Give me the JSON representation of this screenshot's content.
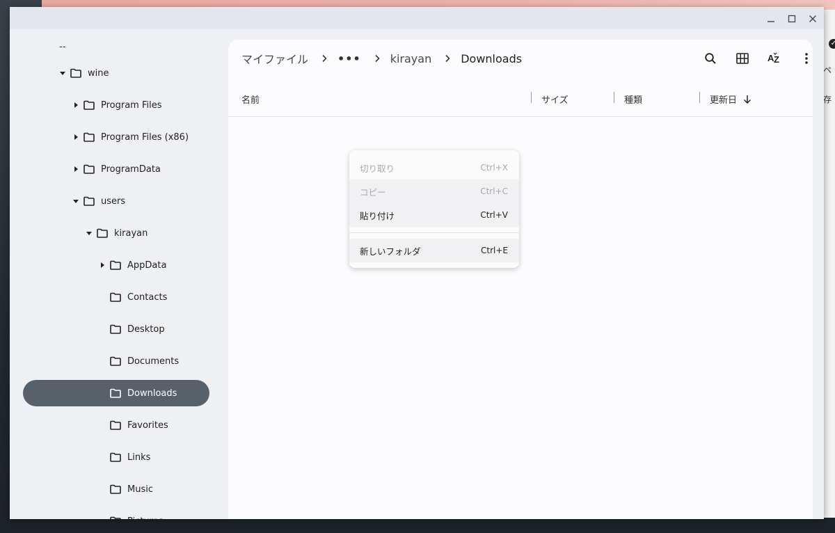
{
  "window": {
    "controls": {
      "minimize_icon": "minimize-icon",
      "maximize_icon": "maximize-icon",
      "close_icon": "close-icon"
    }
  },
  "sidebar": {
    "top_dash": "--",
    "items": [
      {
        "label": "wine",
        "expanded": true,
        "depth": 0,
        "selected": false
      },
      {
        "label": "Program Files",
        "expanded": false,
        "depth": 1,
        "selected": false
      },
      {
        "label": "Program Files (x86)",
        "expanded": false,
        "depth": 1,
        "selected": false
      },
      {
        "label": "ProgramData",
        "expanded": false,
        "depth": 1,
        "selected": false
      },
      {
        "label": "users",
        "expanded": true,
        "depth": 1,
        "selected": false
      },
      {
        "label": "kirayan",
        "expanded": true,
        "depth": 2,
        "selected": false
      },
      {
        "label": "AppData",
        "expanded": false,
        "depth": 3,
        "selected": false
      },
      {
        "label": "Contacts",
        "expanded": null,
        "depth": 3,
        "selected": false
      },
      {
        "label": "Desktop",
        "expanded": null,
        "depth": 3,
        "selected": false
      },
      {
        "label": "Documents",
        "expanded": null,
        "depth": 3,
        "selected": false
      },
      {
        "label": "Downloads",
        "expanded": null,
        "depth": 3,
        "selected": true
      },
      {
        "label": "Favorites",
        "expanded": null,
        "depth": 3,
        "selected": false
      },
      {
        "label": "Links",
        "expanded": null,
        "depth": 3,
        "selected": false
      },
      {
        "label": "Music",
        "expanded": null,
        "depth": 3,
        "selected": false
      },
      {
        "label": "Pictures",
        "expanded": null,
        "depth": 3,
        "selected": false
      }
    ]
  },
  "breadcrumb": {
    "root": "マイファイル",
    "more": "•••",
    "parent": "kirayan",
    "current": "Downloads"
  },
  "toolbar": {
    "search_icon": "search-icon",
    "grid_view_icon": "grid-view-icon",
    "sort_icon": "sort-az-icon",
    "more_icon": "more-vert-icon"
  },
  "columns": {
    "name": "名前",
    "size": "サイズ",
    "type": "種類",
    "modified": "更新日",
    "sort_direction_icon": "arrow-down-icon"
  },
  "context_menu": {
    "items": [
      {
        "label": "切り取り",
        "shortcut": "Ctrl+X",
        "enabled": false
      },
      {
        "label": "コピー",
        "shortcut": "Ctrl+C",
        "enabled": false
      },
      {
        "label": "貼り付け",
        "shortcut": "Ctrl+V",
        "enabled": true
      },
      {
        "label": "新しいフォルダ",
        "shortcut": "Ctrl+E",
        "enabled": true
      }
    ]
  },
  "background": {
    "right_text_1": "ペ",
    "right_text_2": "存"
  }
}
